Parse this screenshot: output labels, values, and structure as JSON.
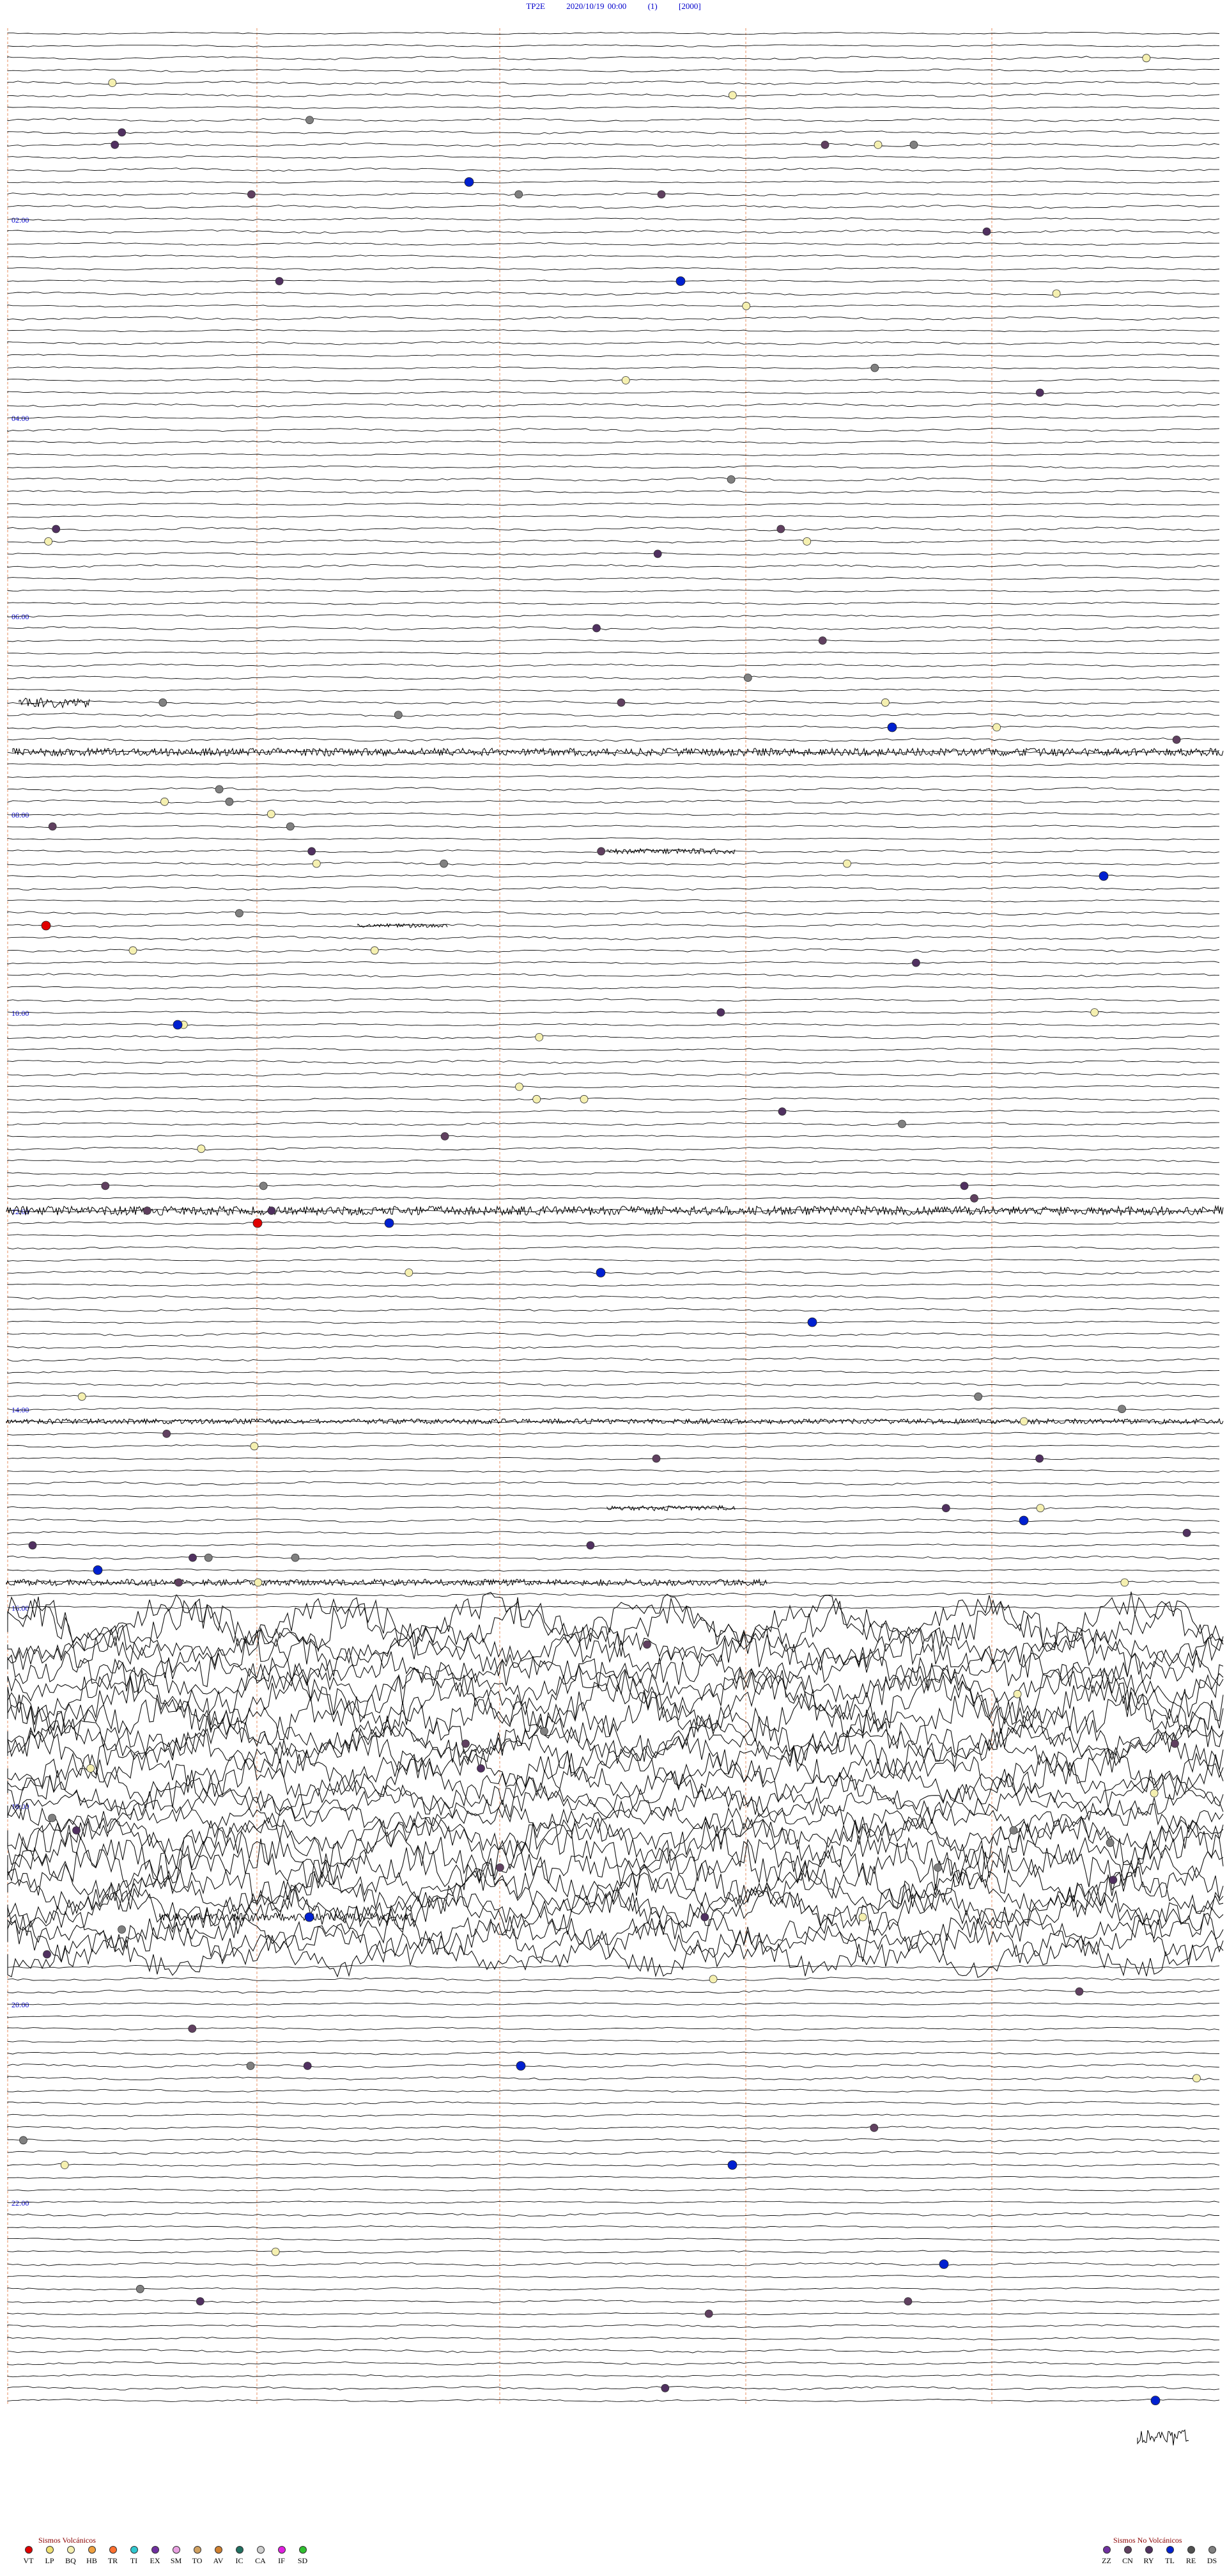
{
  "header": {
    "station": "TP2E",
    "datetime": "2020/10/19 00:00",
    "channel": "(1)",
    "scale": "[2000]"
  },
  "chart_data": {
    "type": "line",
    "title": "TP2E 2020/10/19 00:00 (1) [2000]",
    "hour_labels": [
      "02:00",
      "04:00",
      "06:00",
      "08:00",
      "10:00",
      "12:00",
      "14:00",
      "16:00",
      "18:00",
      "20:00",
      "22:00"
    ],
    "traces_per_hour": 8,
    "trace_minutes": 15,
    "events": [
      {
        "type": "VT",
        "hour": 9.0
      },
      {
        "type": "VT",
        "hour": 12.0
      },
      {
        "type": "TL",
        "hour": 1.5
      },
      {
        "type": "TL",
        "hour": 2.5
      },
      {
        "type": "TL",
        "hour": 7.0
      },
      {
        "type": "TL",
        "hour": 8.5
      },
      {
        "type": "TL",
        "hour": 10.0
      },
      {
        "type": "TL",
        "hour": 12.0
      },
      {
        "type": "TL",
        "hour": 12.5
      },
      {
        "type": "TL",
        "hour": 13.0
      },
      {
        "type": "TL",
        "hour": 15.0
      },
      {
        "type": "TL",
        "hour": 15.5
      },
      {
        "type": "TL",
        "hour": 19.0
      },
      {
        "type": "TL",
        "hour": 20.5
      },
      {
        "type": "TL",
        "hour": 21.5
      },
      {
        "type": "TL",
        "hour": 22.5
      },
      {
        "type": "TL",
        "hour": 24.0
      }
    ]
  },
  "legend_left": {
    "title": "Sismos Volcánicos",
    "items": [
      {
        "code": "VT",
        "color": "#e00000"
      },
      {
        "code": "LP",
        "color": "#f0e070"
      },
      {
        "code": "BQ",
        "color": "#f5f0b0"
      },
      {
        "code": "HB",
        "color": "#f0a040"
      },
      {
        "code": "TR",
        "color": "#ff7030"
      },
      {
        "code": "TI",
        "color": "#30c8d0"
      },
      {
        "code": "EX",
        "color": "#7030a0"
      },
      {
        "code": "SM",
        "color": "#e8a0e0"
      },
      {
        "code": "TO",
        "color": "#d0a060"
      },
      {
        "code": "AV",
        "color": "#d08030"
      },
      {
        "code": "IC",
        "color": "#207060"
      },
      {
        "code": "CA",
        "color": "#d0d0d0"
      },
      {
        "code": "IF",
        "color": "#e020e0"
      },
      {
        "code": "SD",
        "color": "#30c030"
      }
    ]
  },
  "legend_right": {
    "title": "Sismos No Volcánicos",
    "items": [
      {
        "code": "ZZ",
        "color": "#7030a0"
      },
      {
        "code": "CN",
        "color": "#604060"
      },
      {
        "code": "RY",
        "color": "#503060"
      },
      {
        "code": "TL",
        "color": "#0020d0"
      },
      {
        "code": "RE",
        "color": "#505050"
      },
      {
        "code": "DS",
        "color": "#808080"
      }
    ]
  }
}
